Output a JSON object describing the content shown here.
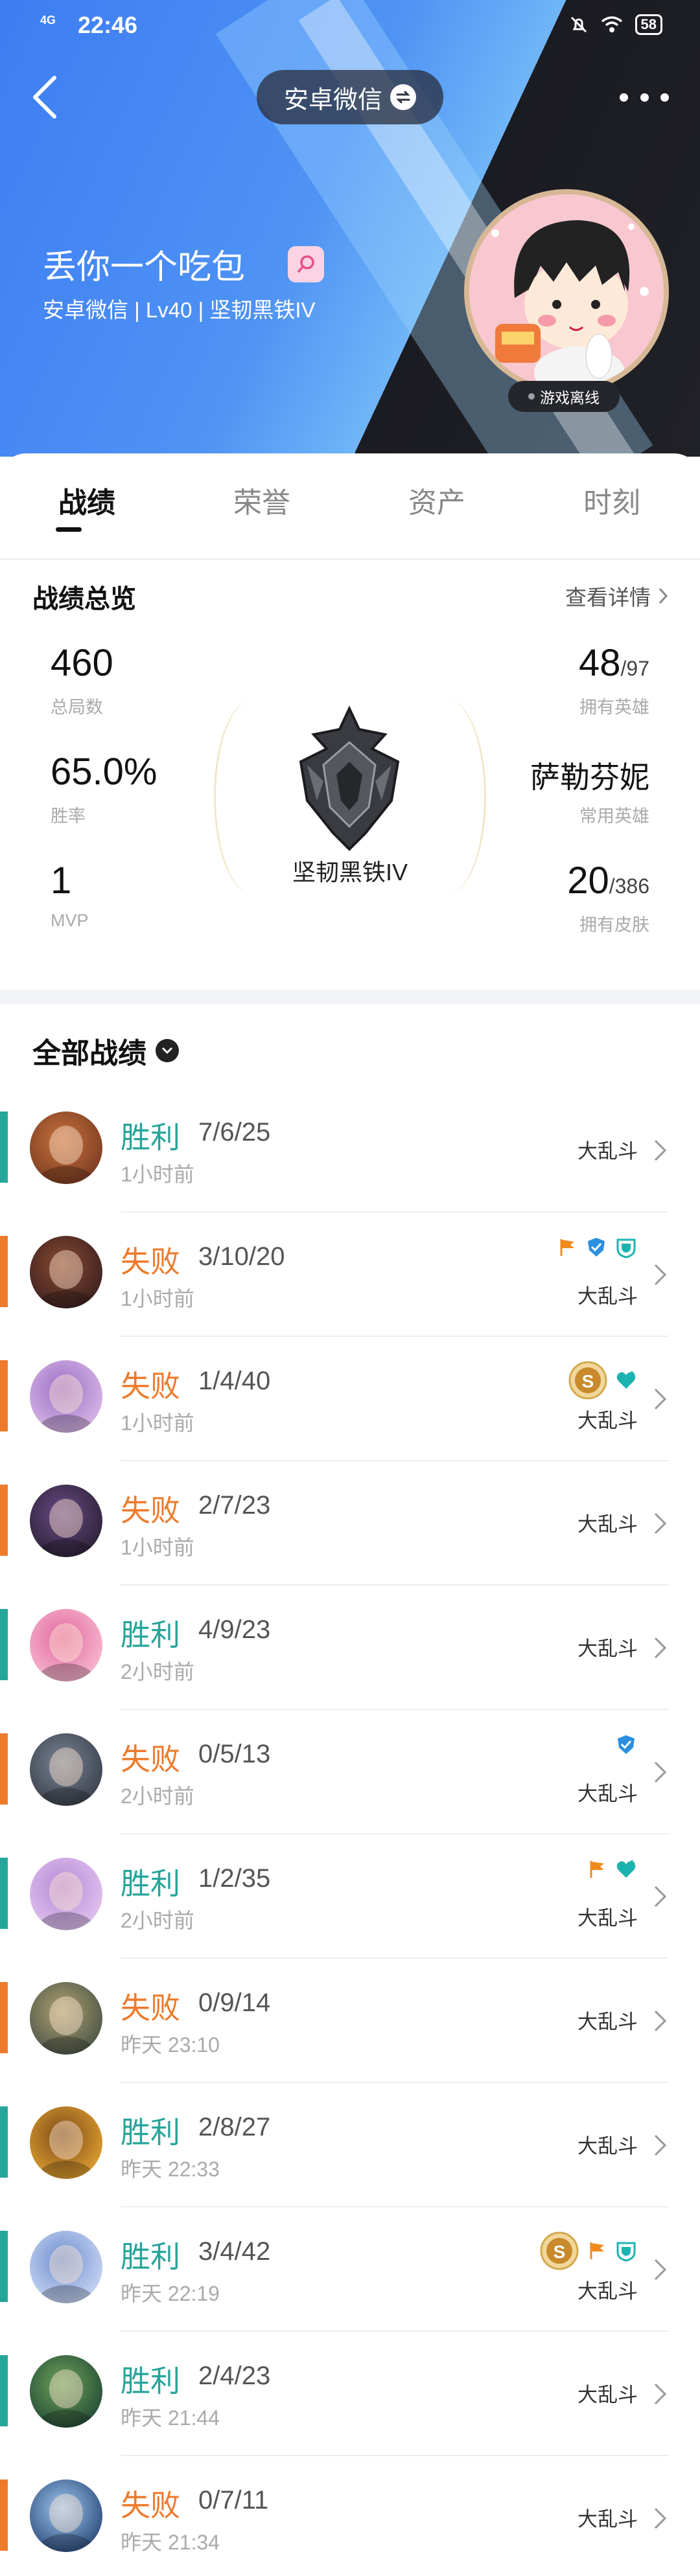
{
  "status": {
    "network": "4G",
    "time": "22:46",
    "battery": "58"
  },
  "header": {
    "account_switch": "安卓微信",
    "nickname": "丢你一个吃包",
    "subinfo": "安卓微信 | Lv40 | 坚韧黑铁IV",
    "status_badge": "游戏离线"
  },
  "tabs": [
    {
      "label": "战绩"
    },
    {
      "label": "荣誉"
    },
    {
      "label": "资产"
    },
    {
      "label": "时刻"
    }
  ],
  "overview": {
    "title": "战绩总览",
    "detail_link": "查看详情",
    "total_games": "460",
    "total_games_label": "总局数",
    "win_rate": "65.0%",
    "win_rate_label": "胜率",
    "mvp": "1",
    "mvp_label": "MVP",
    "heroes_owned": "48",
    "heroes_total": "/97",
    "heroes_label": "拥有英雄",
    "common_hero": "萨勒芬妮",
    "common_hero_label": "常用英雄",
    "skins_owned": "20",
    "skins_total": "/386",
    "skins_label": "拥有皮肤",
    "rank": "坚韧黑铁IV"
  },
  "history": {
    "title": "全部战绩",
    "matches": [
      {
        "result": "胜利",
        "kda": "7/6/25",
        "time": "1小时前",
        "mode": "大乱斗",
        "badges": []
      },
      {
        "result": "失败",
        "kda": "3/10/20",
        "time": "1小时前",
        "mode": "大乱斗",
        "badges": [
          "flag-badge-icon",
          "shield-badge-icon",
          "defense-badge-icon"
        ]
      },
      {
        "result": "失败",
        "kda": "1/4/40",
        "time": "1小时前",
        "mode": "大乱斗",
        "badges": [
          "s-rating-icon",
          "heal-badge-icon"
        ]
      },
      {
        "result": "失败",
        "kda": "2/7/23",
        "time": "1小时前",
        "mode": "大乱斗",
        "badges": []
      },
      {
        "result": "胜利",
        "kda": "4/9/23",
        "time": "2小时前",
        "mode": "大乱斗",
        "badges": []
      },
      {
        "result": "失败",
        "kda": "0/5/13",
        "time": "2小时前",
        "mode": "大乱斗",
        "badges": [
          "shield-badge-icon"
        ]
      },
      {
        "result": "胜利",
        "kda": "1/2/35",
        "time": "2小时前",
        "mode": "大乱斗",
        "badges": [
          "flag-badge-icon",
          "heal-badge-icon"
        ]
      },
      {
        "result": "失败",
        "kda": "0/9/14",
        "time": "昨天 23:10",
        "mode": "大乱斗",
        "badges": []
      },
      {
        "result": "胜利",
        "kda": "2/8/27",
        "time": "昨天 22:33",
        "mode": "大乱斗",
        "badges": []
      },
      {
        "result": "胜利",
        "kda": "3/4/42",
        "time": "昨天 22:19",
        "mode": "大乱斗",
        "badges": [
          "s-rating-icon",
          "flag-badge-icon",
          "defense-badge-icon"
        ]
      },
      {
        "result": "胜利",
        "kda": "2/4/23",
        "time": "昨天 21:44",
        "mode": "大乱斗",
        "badges": []
      },
      {
        "result": "失败",
        "kda": "0/7/11",
        "time": "昨天 21:34",
        "mode": "大乱斗",
        "badges": []
      }
    ]
  },
  "colors": {
    "win": "#26a59a",
    "loss": "#ee7a2c",
    "brand_blue": "#3d7df2"
  }
}
